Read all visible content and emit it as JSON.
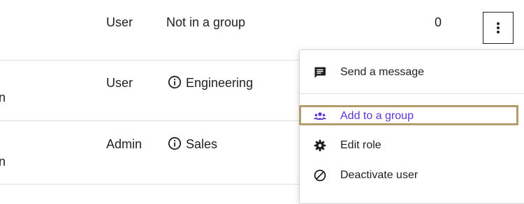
{
  "rows": [
    {
      "role": "User",
      "group": "Not in a group",
      "group_has_info": false,
      "count": "0",
      "name_fragment": ""
    },
    {
      "role": "User",
      "group": "Engineering",
      "group_has_info": true,
      "count": "",
      "name_fragment": "n"
    },
    {
      "role": "Admin",
      "group": "Sales",
      "group_has_info": true,
      "count": "",
      "name_fragment": "n"
    }
  ],
  "more_button": {
    "icon": "more-vertical-icon"
  },
  "menu": {
    "items": [
      {
        "label": "Send a message",
        "icon": "message-icon"
      },
      {
        "label": "Add to a group",
        "icon": "group-icon",
        "highlighted": true
      },
      {
        "label": "Edit role",
        "icon": "gear-icon"
      },
      {
        "label": "Deactivate user",
        "icon": "block-icon"
      }
    ]
  },
  "colors": {
    "accent": "#5b36d6",
    "highlight_border": "#b59b6b",
    "divider": "#dcdcdc"
  }
}
